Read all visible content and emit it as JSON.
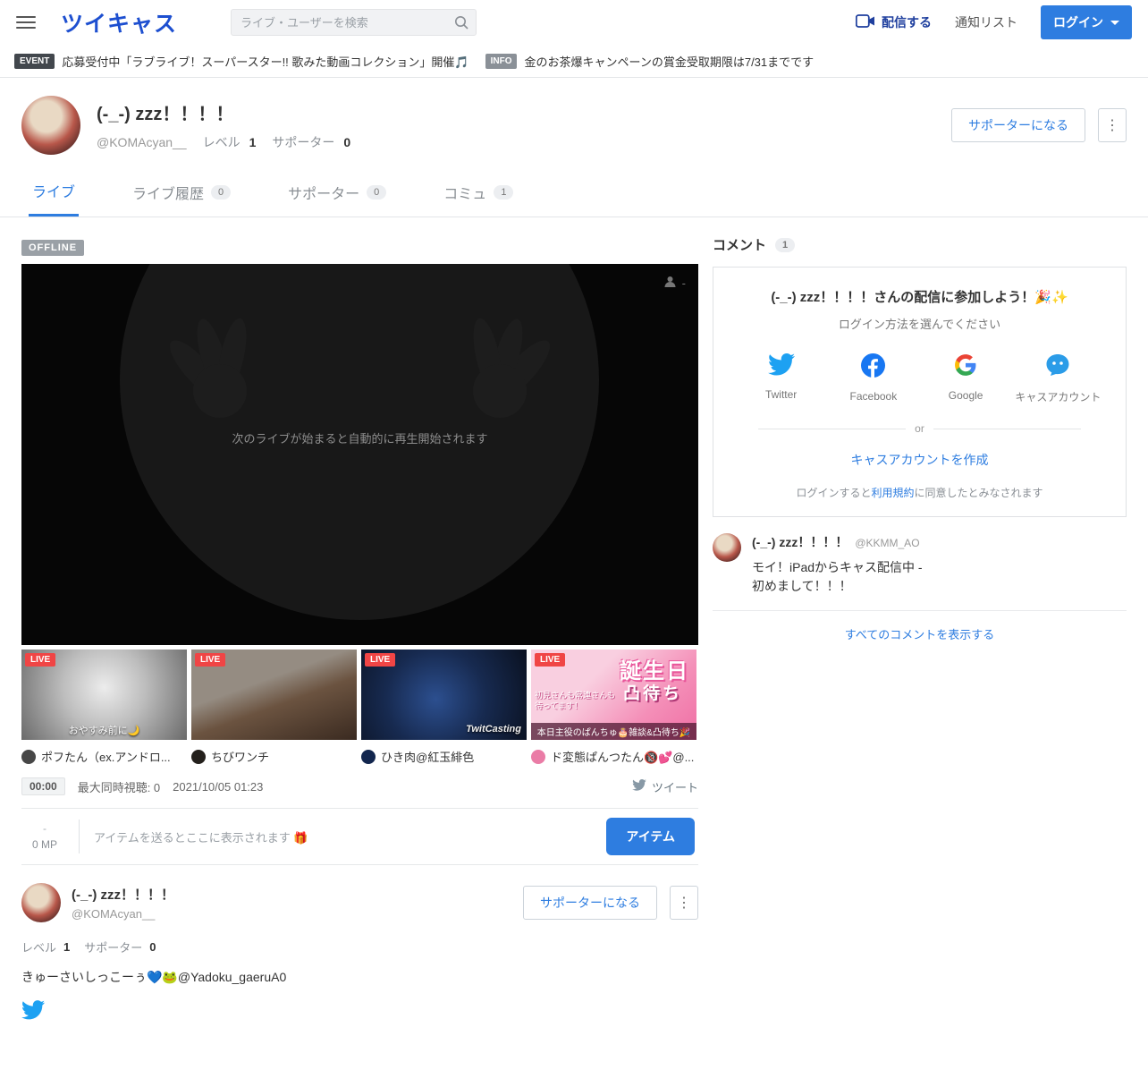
{
  "colors": {
    "brand_blue": "#1d4fd0",
    "accent_blue": "#2e7de0",
    "live_red": "#f04545",
    "twitter_blue": "#1da1f2",
    "facebook_blue": "#1877f2"
  },
  "header": {
    "logo": "ツイキャス",
    "search_placeholder": "ライブ・ユーザーを検索",
    "broadcast_label": "配信する",
    "notifications_label": "通知リスト",
    "login_label": "ログイン"
  },
  "notice": {
    "event_badge": "EVENT",
    "event_text": "応募受付中「ラブライブ！スーパースター!! 歌みた動画コレクション」開催🎵",
    "info_badge": "INFO",
    "info_text": "金のお茶爆キャンペーンの賞金受取期限は7/31までです"
  },
  "profile": {
    "name": "(-_-) zzz！！！！",
    "username": "@KOMAcyan__",
    "level_label": "レベル",
    "level_value": "1",
    "supporter_label": "サポーター",
    "supporter_value": "0",
    "become_supporter_label": "サポーターになる",
    "menu_icon": "⋮"
  },
  "tabs": [
    {
      "label": "ライブ"
    },
    {
      "label": "ライブ履歴",
      "count": "0"
    },
    {
      "label": "サポーター",
      "count": "0"
    },
    {
      "label": "コミュ",
      "count": "1"
    }
  ],
  "player": {
    "offline_badge": "OFFLINE",
    "message": "次のライブが始まると自動的に再生開始されます",
    "viewer_count": "-"
  },
  "recommended": [
    {
      "live_badge": "LIVE",
      "overlay_caption": "おやすみ前に🌙",
      "name": "ポフたん（ex.アンドロ..."
    },
    {
      "live_badge": "LIVE",
      "name": "ちびワンチ"
    },
    {
      "live_badge": "LIVE",
      "watermark": "TwitCasting",
      "name": "ひき肉@紅玉緋色"
    },
    {
      "live_badge": "LIVE",
      "overlay_title_1": "誕生日",
      "overlay_title_2": "凸待ち",
      "overlay_sub_1": "初見さんも常連さんも",
      "overlay_sub_2": "待ってます！",
      "overlay_caption": "本日主役のぱんちゅ🎂雑談&凸待ち🎉",
      "name": "ド変態ぱんつたん🔞💕@..."
    }
  ],
  "stats": {
    "duration": "00:00",
    "max_viewers": "最大同時視聴: 0",
    "date": "2021/10/05 01:23",
    "tweet_label": "ツイート"
  },
  "item_bar": {
    "points_dash": "-",
    "points": "0 MP",
    "hint": "アイテムを送るとここに表示されます 🎁",
    "item_button_label": "アイテム"
  },
  "profile_lower": {
    "name": "(-_-) zzz！！！！",
    "username": "@KOMAcyan__",
    "become_supporter_label": "サポーターになる",
    "menu_icon": "⋮",
    "level_label": "レベル",
    "level_value": "1",
    "supporter_label": "サポーター",
    "supporter_value": "0",
    "bio": "きゅーさいしっこーぅ💙🐸@Yadoku_gaeruA0"
  },
  "comments": {
    "header": "コメント",
    "count": "1",
    "login_box": {
      "title": "(-_-) zzz！！！！さんの配信に参加しよう！🎉✨",
      "subtitle": "ログイン方法を選んでください",
      "providers": [
        {
          "label": "Twitter"
        },
        {
          "label": "Facebook"
        },
        {
          "label": "Google"
        },
        {
          "label": "キャスアカウント"
        }
      ],
      "or_label": "or",
      "create_account_label": "キャスアカウントを作成",
      "terms_prefix": "ログインすると",
      "terms_link": "利用規約",
      "terms_suffix": "に同意したとみなされます"
    },
    "first_comment": {
      "name": "(-_-) zzz！！！！",
      "username": "@KKMM_AO",
      "line1": "モイ！iPadからキャス配信中 -",
      "line2": "初めまして！！！"
    },
    "show_all_label": "すべてのコメントを表示する"
  }
}
